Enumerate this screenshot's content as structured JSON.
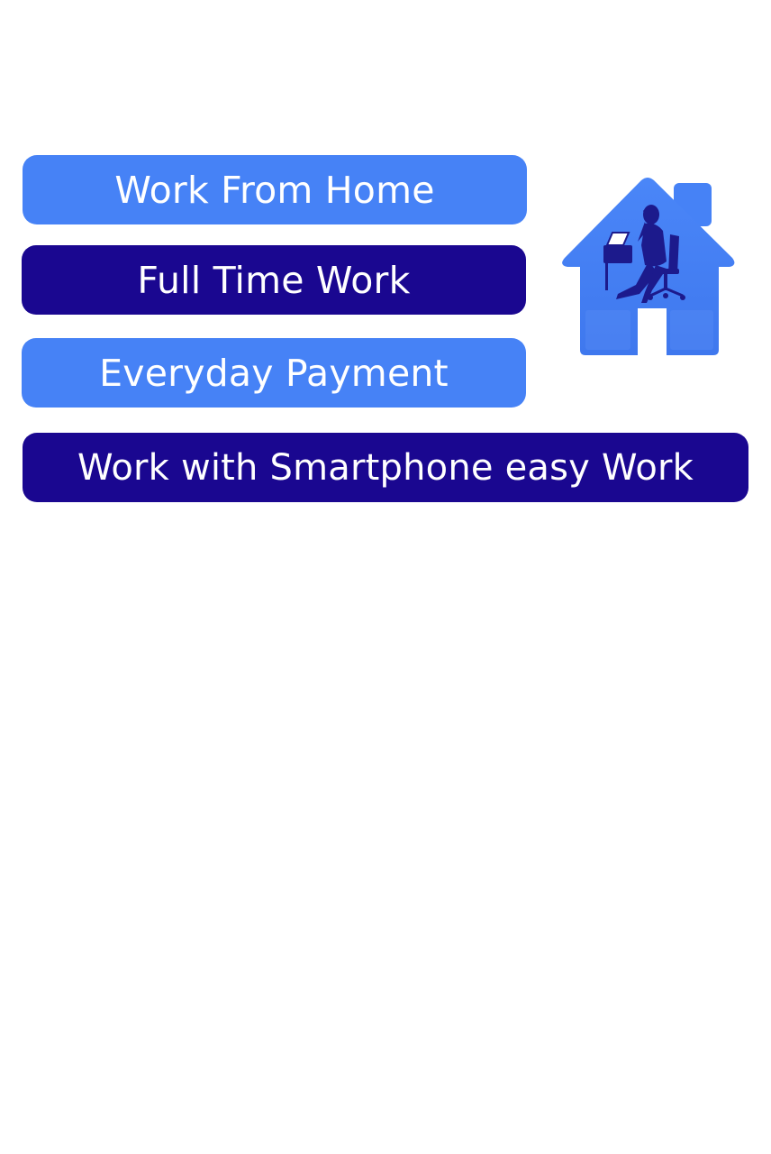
{
  "features": {
    "items": [
      {
        "label": "Work From Home",
        "style": "light"
      },
      {
        "label": "Full Time Work",
        "style": "dark"
      },
      {
        "label": "Everyday Payment",
        "style": "light"
      },
      {
        "label": "Work with Smartphone easy Work",
        "style": "dark"
      }
    ]
  },
  "logo": {
    "icon": "house-with-person-at-laptop-icon"
  },
  "colors": {
    "light_blue": "#4682f6",
    "dark_navy": "#1a0790",
    "figure": "#1c1a8c",
    "background": "#ffffff"
  }
}
